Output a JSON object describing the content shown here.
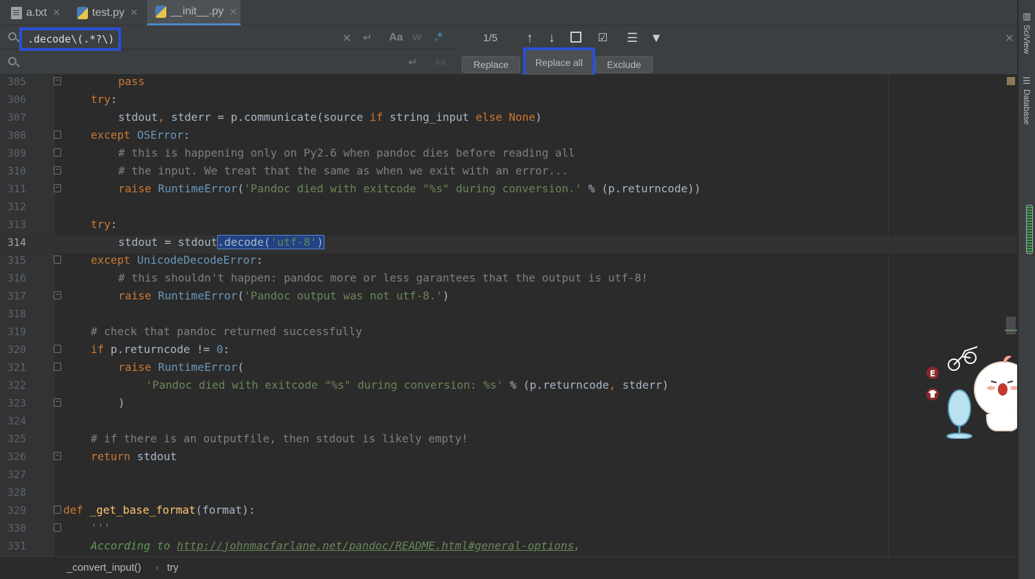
{
  "tabs": [
    {
      "label": "a.txt",
      "icon": "text-file-icon"
    },
    {
      "label": "test.py",
      "icon": "python-file-icon"
    },
    {
      "label": "__init__.py",
      "icon": "python-file-icon",
      "active": true
    }
  ],
  "find": {
    "value": ".decode\\(.*?\\)",
    "replace_value": "",
    "match_count": "1/5",
    "replace_label": "Replace",
    "replace_all_label": "Replace all",
    "exclude_label": "Exclude"
  },
  "editor": {
    "lines": [
      {
        "n": "305"
      },
      {
        "n": "306"
      },
      {
        "n": "307"
      },
      {
        "n": "308"
      },
      {
        "n": "309"
      },
      {
        "n": "310"
      },
      {
        "n": "311"
      },
      {
        "n": "312"
      },
      {
        "n": "313"
      },
      {
        "n": "314"
      },
      {
        "n": "315"
      },
      {
        "n": "316"
      },
      {
        "n": "317"
      },
      {
        "n": "318"
      },
      {
        "n": "319"
      },
      {
        "n": "320"
      },
      {
        "n": "321"
      },
      {
        "n": "322"
      },
      {
        "n": "323"
      },
      {
        "n": "324"
      },
      {
        "n": "325"
      },
      {
        "n": "326"
      },
      {
        "n": "327"
      },
      {
        "n": "328"
      },
      {
        "n": "329"
      },
      {
        "n": "330"
      },
      {
        "n": "331"
      }
    ],
    "code": {
      "l305_pass": "pass",
      "l306_try": "try",
      "l307_a": "stdout",
      "l307_b": ", ",
      "l307_c": "stderr = p.communicate(source ",
      "l307_if": "if",
      "l307_d": " string_input ",
      "l307_else": "else",
      "l307_none": "None",
      "l307_e": ")",
      "l308_except": "except",
      "l308_cls": "OSError",
      "l308_colon": ":",
      "l309": "# this is happening only on Py2.6 when pandoc dies before reading all",
      "l310": "# the input. We treat that the same as when we exit with an error...",
      "l311_raise": "raise",
      "l311_cls": "RuntimeError",
      "l311_open": "(",
      "l311_str": "'Pandoc died with exitcode \"%s\" during conversion.'",
      "l311_rest": " % (p.returncode))",
      "l313_try": "try",
      "l313_colon": ":",
      "l314_a": "stdout = stdout",
      "l314_dot": ".decode(",
      "l314_str": "'utf-8'",
      "l314_close": ")",
      "l315_except": "except",
      "l315_cls": "UnicodeDecodeError",
      "l315_colon": ":",
      "l316": "# this shouldn't happen: pandoc more or less garantees that the output is utf-8!",
      "l317_raise": "raise",
      "l317_cls": "RuntimeError",
      "l317_open": "(",
      "l317_str": "'Pandoc output was not utf-8.'",
      "l317_close": ")",
      "l319": "# check that pandoc returned successfully",
      "l320_if": "if",
      "l320_a": " p.returncode != ",
      "l320_num": "0",
      "l320_colon": ":",
      "l321_raise": "raise",
      "l321_cls": "RuntimeError",
      "l321_open": "(",
      "l322_str": "'Pandoc died with exitcode \"%s\" during conversion: %s'",
      "l322_rest": " % (p.returncode",
      "l322_comma": ", ",
      "l322_end": "stderr)",
      "l323": ")",
      "l325": "# if there is an outputfile, then stdout is likely empty!",
      "l326_return": "return",
      "l326_a": " stdout",
      "l329_def": "def",
      "l329_fn": "_get_base_format",
      "l329_a": "(format):",
      "l330": "'''",
      "l331_a": "According to ",
      "l331_link": "http://johnmacfarlane.net/pandoc/README.html#general-options",
      "l331_b": ","
    }
  },
  "breadcrumb": {
    "items": [
      "_convert_input()",
      "try"
    ],
    "separator": "›"
  },
  "right_strip": {
    "sciview": "SciView",
    "database": "Database"
  },
  "colors": {
    "accent": "#2a4fd8",
    "keyword": "#cc7832",
    "string": "#6a8759",
    "class": "#6897bb"
  }
}
